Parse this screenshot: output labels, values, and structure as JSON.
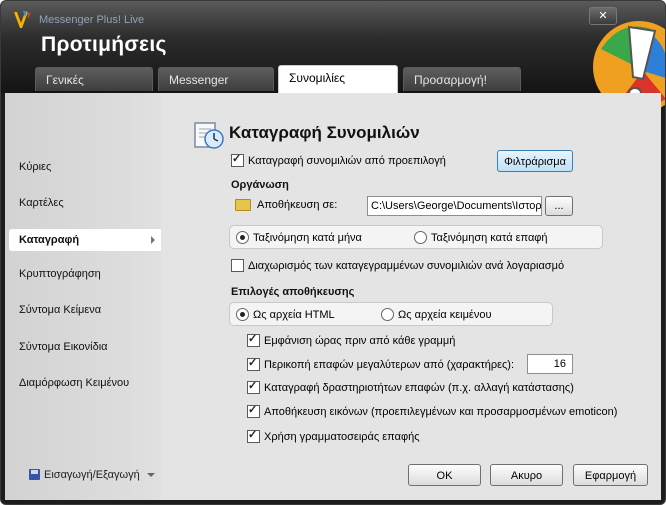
{
  "window": {
    "app_title": "Messenger Plus! Live",
    "page_title": "Προτιμήσεις",
    "close_label": "✕"
  },
  "tabs": [
    {
      "label": "Γενικές"
    },
    {
      "label": "Messenger"
    },
    {
      "label": "Συνομιλίες"
    },
    {
      "label": "Προσαρμογή!"
    }
  ],
  "sidebar": {
    "items": [
      {
        "label": "Κύριες"
      },
      {
        "label": "Καρτέλες"
      },
      {
        "label": "Καταγραφή"
      },
      {
        "label": "Κρυπτογράφηση"
      },
      {
        "label": "Σύντομα Κείμενα"
      },
      {
        "label": "Σύντομα Εικονίδια"
      },
      {
        "label": "Διαμόρφωση Κειμένου"
      }
    ],
    "import_export": "Εισαγωγή/Εξαγωγή"
  },
  "main": {
    "title": "Καταγραφή Συνομιλιών",
    "log_default": "Καταγραφή συνομιλιών από προεπιλογή",
    "filter_button": "Φιλτράρισμα",
    "organization_label": "Οργάνωση",
    "save_in_label": "Αποθήκευση σε:",
    "save_path": "C:\\Users\\George\\Documents\\Ιστορ",
    "browse_button": "...",
    "sort_month": "Ταξινόμηση κατά μήνα",
    "sort_contact": "Ταξινόμηση κατά επαφή",
    "separate_accounts": "Διαχωρισμός των καταγεγραμμένων συνομιλιών ανά λογαριασμό",
    "save_options_label": "Επιλογές αποθήκευσης",
    "as_html": "Ως αρχεία HTML",
    "as_text": "Ως αρχεία κειμένου",
    "show_time": "Εμφάνιση ώρας πριν από κάθε γραμμή",
    "truncate_contacts": "Περικοπή επαφών μεγαλύτερων από (χαρακτήρες):",
    "truncate_value": "16",
    "log_activity": "Καταγραφή δραστηριοτήτων επαφών  (π.χ. αλλαγή κατάστασης)",
    "save_images": "Αποθήκευση εικόνων (προεπιλεγμένων και προσαρμοσμένων emoticon)",
    "use_font": "Χρήση γραμματοσειράς επαφής"
  },
  "footer": {
    "ok": "ΟΚ",
    "cancel": "Ακυρο",
    "apply": "Εφαρμογή"
  }
}
